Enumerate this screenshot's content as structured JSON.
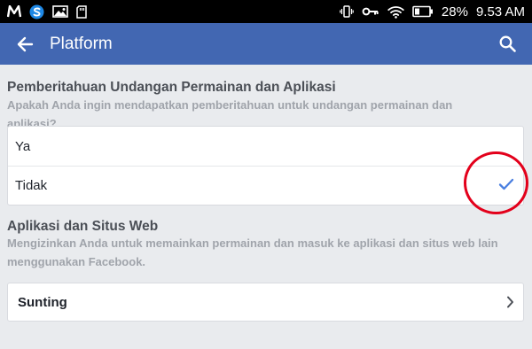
{
  "status_bar": {
    "battery_percent": "28%",
    "time": "9.53 AM",
    "left_icons": [
      "m-app-icon",
      "s-app-icon",
      "gallery-icon",
      "sd-card-icon"
    ],
    "right_icons": [
      "vibrate-icon",
      "key-icon",
      "wifi-icon",
      "battery-icon"
    ]
  },
  "app_bar": {
    "title": "Platform",
    "back_icon": "arrow-left-icon",
    "search_icon": "search-icon",
    "color": "#4267b2"
  },
  "notifications_section": {
    "title": "Pemberitahuan Undangan Permainan dan Aplikasi",
    "description": "Apakah Anda ingin mendapatkan pemberitahuan untuk undangan permainan dan aplikasi?",
    "options": [
      {
        "label": "Ya",
        "selected": false
      },
      {
        "label": "Tidak",
        "selected": true
      }
    ],
    "check_color": "#4a7fe0"
  },
  "apps_section": {
    "title": "Aplikasi dan Situs Web",
    "description": "Mengizinkan Anda untuk memainkan permainan dan masuk ke aplikasi dan situs web lain menggunakan Facebook.",
    "edit_label": "Sunting",
    "chevron_icon": "chevron-right-icon"
  },
  "annotation": {
    "shape": "circle",
    "color": "#e3001b"
  }
}
